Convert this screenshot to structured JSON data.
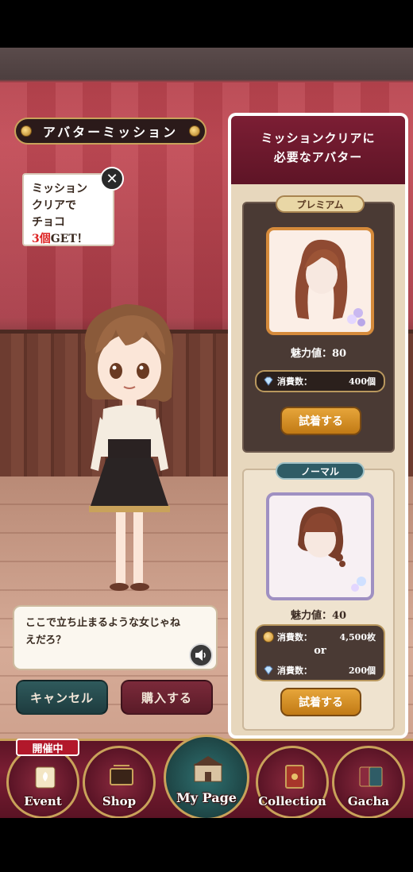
{
  "mission": {
    "title": "アバターミッション",
    "reward_line1": "ミッション",
    "reward_line2": "クリアで",
    "reward_line3": "チョコ",
    "reward_count": "3個",
    "reward_get": "GET！",
    "close_glyph": "✕"
  },
  "dialog": {
    "line1": "ここで立ち止まるような女じゃね",
    "line2": "えだろ？"
  },
  "actions": {
    "cancel_label": "キャンセル",
    "buy_label": "購入する"
  },
  "panel": {
    "header_line1": "ミッションクリアに",
    "header_line2": "必要なアバター",
    "premium": {
      "label": "プレミアム",
      "charm": "魅力値：80",
      "cost_label": "消費数：",
      "cost_value": "400個",
      "try_label": "試着する"
    },
    "normal": {
      "label": "ノーマル",
      "charm": "魅力値：40",
      "cost_label_1": "消費数：",
      "cost_value_1": "4,500枚",
      "or_text": "or",
      "cost_label_2": "消費数：",
      "cost_value_2": "200個",
      "try_label": "試着する"
    }
  },
  "nav": {
    "badge": "開催中",
    "items": [
      {
        "label": "Event",
        "icon": "scroll-icon"
      },
      {
        "label": "Shop",
        "icon": "shop-sign-icon"
      },
      {
        "label": "My Page",
        "icon": "mansion-icon"
      },
      {
        "label": "Collection",
        "icon": "book-icon"
      },
      {
        "label": "Gacha",
        "icon": "cards-icon"
      }
    ]
  },
  "colors": {
    "wine": "#7c1e34",
    "gold": "#c9a25a",
    "teal": "#2f5c66",
    "try_orange": "#e6a53a"
  }
}
